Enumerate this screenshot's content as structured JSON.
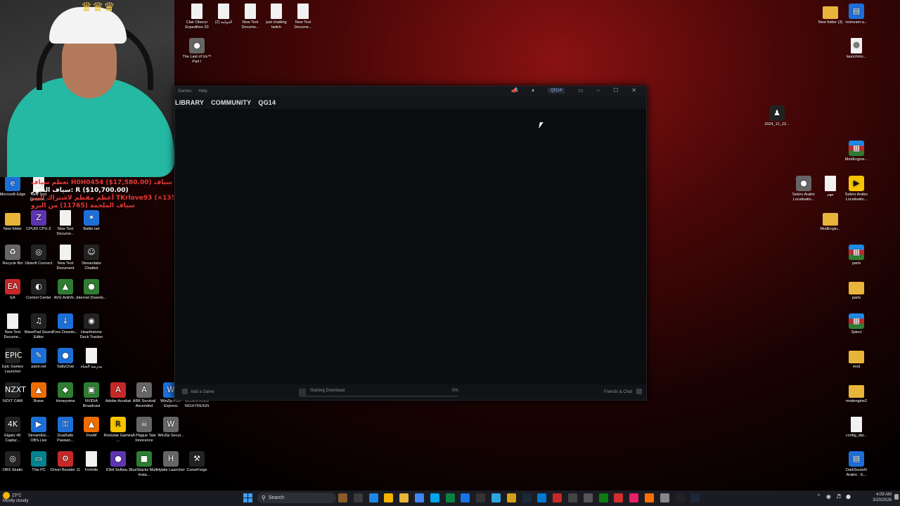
{
  "desktop_icons": {
    "left": [
      {
        "label": "Microsoft Edge",
        "glyph": "e",
        "cls": "g-blue"
      },
      {
        "label": "New Text Docume...",
        "glyph": "",
        "cls": "g-doc"
      },
      {
        "label": "New folder",
        "glyph": "",
        "cls": "g-folder"
      },
      {
        "label": "CPUID CPU-Z",
        "glyph": "Z",
        "cls": "g-purple"
      },
      {
        "label": "New Text Docume...",
        "glyph": "",
        "cls": "g-doc"
      },
      {
        "label": "Battle.net",
        "glyph": "✶",
        "cls": "g-blue"
      },
      {
        "label": "Recycle Bin",
        "glyph": "♻",
        "cls": "g-gray"
      },
      {
        "label": "Ubisoft Connect",
        "glyph": "◎",
        "cls": "g-dark"
      },
      {
        "label": "New Text Document",
        "glyph": "",
        "cls": "g-doc"
      },
      {
        "label": "Streamlabs Chatbot",
        "glyph": "☺",
        "cls": "g-dark"
      },
      {
        "label": "EA",
        "glyph": "EA",
        "cls": "g-red"
      },
      {
        "label": "Control Center",
        "glyph": "◐",
        "cls": "g-dark"
      },
      {
        "label": "AVG AntiVir...",
        "glyph": "▲",
        "cls": "g-green"
      },
      {
        "label": "Internet Downlo...",
        "glyph": "●",
        "cls": "g-green"
      },
      {
        "label": "New Text Docume...",
        "glyph": "",
        "cls": "g-doc"
      },
      {
        "label": "WavePad Sound Editor",
        "glyph": "♫",
        "cls": "g-dark"
      },
      {
        "label": "Free Downlo...",
        "glyph": "↓",
        "cls": "g-blue"
      },
      {
        "label": "Hearthstone Deck Tracker",
        "glyph": "◉",
        "cls": "g-dark"
      },
      {
        "label": "Epic Games Launcher",
        "glyph": "EPIC",
        "cls": "g-dark"
      },
      {
        "label": "paint.net",
        "glyph": "✎",
        "cls": "g-blue"
      },
      {
        "label": "SaltyChat",
        "glyph": "●",
        "cls": "g-blue"
      },
      {
        "label": "مدرسة الحياة",
        "glyph": "",
        "cls": "g-doc"
      },
      {
        "label": "NZXT CAM",
        "glyph": "NZXT",
        "cls": "g-dark"
      },
      {
        "label": "Brave",
        "glyph": "▲",
        "cls": "g-orange"
      },
      {
        "label": "Honeyview",
        "glyph": "◆",
        "cls": "g-green"
      },
      {
        "label": "NVIDIA Broadcast",
        "glyph": "▣",
        "cls": "g-green"
      },
      {
        "label": "Adobe Acrobat",
        "glyph": "A",
        "cls": "g-red"
      },
      {
        "label": "ARK Survival Ascended",
        "glyph": "A",
        "cls": "g-gray"
      },
      {
        "label": "WinZip PDF Express",
        "glyph": "W",
        "cls": "g-blue"
      },
      {
        "label": "ELDEN RING NIGHTREIGN",
        "glyph": "E",
        "cls": "g-dark"
      },
      {
        "label": "Elgato 4K Captur...",
        "glyph": "4K",
        "cls": "g-dark"
      },
      {
        "label": "StreamEle... OBS.Live",
        "glyph": "▶",
        "cls": "g-blue"
      },
      {
        "label": "DualSafe Passwo...",
        "glyph": "⚿",
        "cls": "g-blue"
      },
      {
        "label": "FiveM",
        "glyph": "▲",
        "cls": "g-orange"
      },
      {
        "label": "Rockstar Games ...",
        "glyph": "R",
        "cls": "g-yellow"
      },
      {
        "label": "A Plague Tale Innocence",
        "glyph": "☠",
        "cls": "g-gray"
      },
      {
        "label": "WinZip Secur...",
        "glyph": "W",
        "cls": "g-gray"
      },
      {
        "label": "OBS Studio",
        "glyph": "◎",
        "cls": "g-dark"
      },
      {
        "label": "This PC",
        "glyph": "▭",
        "cls": "g-teal"
      },
      {
        "label": "Driver Booster 11",
        "glyph": "⚙",
        "cls": "g-red"
      },
      {
        "label": "Fortnite",
        "glyph": "",
        "cls": "g-doc"
      },
      {
        "label": "IObit Softwa...",
        "glyph": "●",
        "cls": "g-purple"
      },
      {
        "label": "BlueStacks Multi-Insta...",
        "glyph": "■",
        "cls": "g-green"
      },
      {
        "label": "Hytale Launcher",
        "glyph": "H",
        "cls": "g-gray"
      },
      {
        "label": "CurseForge",
        "glyph": "⚒",
        "cls": "g-dark"
      }
    ],
    "top": [
      {
        "label": "Clair Obscur Expedition 33",
        "glyph": "",
        "cls": "g-doc"
      },
      {
        "label": "الدوامة (2)",
        "glyph": "",
        "cls": "g-doc"
      },
      {
        "label": "New Text Docume...",
        "glyph": "",
        "cls": "g-doc"
      },
      {
        "label": "just chatting twitch",
        "glyph": "",
        "cls": "g-doc"
      },
      {
        "label": "New Text Docume...",
        "glyph": "",
        "cls": "g-doc"
      },
      {
        "label": "The Last of Us™ Part I",
        "glyph": "●",
        "cls": "g-gray"
      }
    ],
    "right": [
      {
        "label": "New folder (3)",
        "glyph": "",
        "cls": "g-folder"
      },
      {
        "label": "restream-a...",
        "glyph": "▤",
        "cls": "g-blue"
      },
      {
        "label": "launchmo...",
        "glyph": "⚙",
        "cls": "g-doc"
      },
      {
        "label": "2024_12_23...",
        "glyph": "♟",
        "cls": "g-dark"
      },
      {
        "label": "ModEngine...",
        "glyph": "▦",
        "cls": "g-rar"
      },
      {
        "label": "Sekiro Arabic Localisatio...",
        "glyph": "●",
        "cls": "g-gray"
      },
      {
        "label": "مهم",
        "glyph": "",
        "cls": "g-doc"
      },
      {
        "label": "Sekiro Arabic Localisatio...",
        "glyph": "▶",
        "cls": "g-yellow"
      },
      {
        "label": "ModEngin...",
        "glyph": "",
        "cls": "g-folder"
      },
      {
        "label": "parts",
        "glyph": "▦",
        "cls": "g-rar"
      },
      {
        "label": "parts",
        "glyph": "",
        "cls": "g-folder"
      },
      {
        "label": "3plect",
        "glyph": "▦",
        "cls": "g-rar"
      },
      {
        "label": "mod",
        "glyph": "",
        "cls": "g-folder"
      },
      {
        "label": "modengine2",
        "glyph": "",
        "cls": "g-folder"
      },
      {
        "label": "config_dar...",
        "glyph": "",
        "cls": "g-doc"
      },
      {
        "label": "DarkSoulsIII Arabic - E...",
        "glyph": "▤",
        "cls": "g-blue"
      }
    ]
  },
  "webcam": {
    "chat_lines": [
      {
        "text": "تعظم سياف H0H0454 ($17,580.00) أعظم سياف",
        "cls": "chat-red"
      },
      {
        "text": "سياف الشهر: R ($10,700.00)",
        "cls": "chat-white"
      },
      {
        "text": "أعظم مقطم لاشتراك البير TKrlove93 (×1355)",
        "cls": "chat-red"
      },
      {
        "text": "سياف الملحمة (11765) من البرو",
        "cls": "chat-red"
      }
    ]
  },
  "steam": {
    "menu": [
      "Games",
      "Help"
    ],
    "user": "QG14",
    "nav": [
      "LIBRARY",
      "COMMUNITY",
      "QG14"
    ],
    "add_game": "Add a Game",
    "download_status": "Starting Download",
    "download_percent": "0%",
    "download_progress": 0,
    "friends_chat": "Friends & Chat"
  },
  "taskbar": {
    "weather_temp": "23°C",
    "weather_desc": "Mostly cloudy",
    "search_label": "Search",
    "time": "4:09 AM",
    "date": "3/20/2026",
    "app_colors": [
      "#8b5a2b",
      "#3a3a3a",
      "#1e88e5",
      "#f4b400",
      "#e8b43a",
      "#4285f4",
      "#00a4ef",
      "#0b8043",
      "#1a73e8",
      "#333",
      "#2ca5e0",
      "#d4a017",
      "#1b2838",
      "#0078d4",
      "#c62828",
      "#444",
      "#555",
      "#107c10",
      "#d32f2f",
      "#e91e63",
      "#ff6f00",
      "#888",
      "#222",
      "#1b2838"
    ]
  }
}
